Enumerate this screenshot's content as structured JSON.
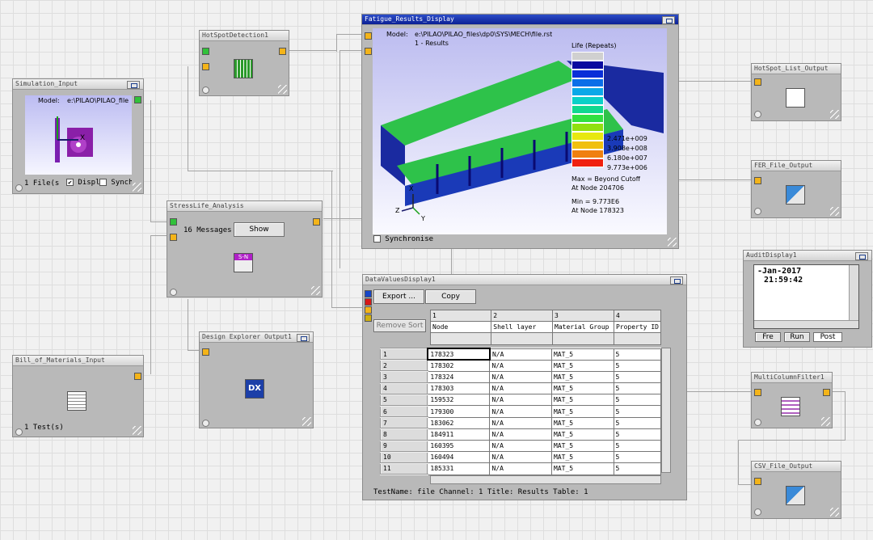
{
  "nodes": {
    "hotspot": {
      "title": "HotSpotDetection1"
    },
    "sim": {
      "title": "Simulation_Input",
      "model": "Model:",
      "path": "e:\\PILAO\\PILAO_file",
      "files": "1 File(s",
      "disp": "Displ",
      "sync": "Synch"
    },
    "fatigue": {
      "title": "Fatigue_Results_Display",
      "model": "Model:",
      "path": "e:\\PILAO\\PILAO_files\\dp0\\SYS\\MECH\\file.rst",
      "results": "1 - Results",
      "legend_title": "Life (Repeats)",
      "legend_values": [
        "2.471e+009",
        "3.908e+008",
        "6.180e+007",
        "9.773e+006"
      ],
      "max": "Max = Beyond Cutoff",
      "max_node": "At Node 204706",
      "min": "Min = 9.773E6",
      "min_node": "At Node 178323",
      "synchronise": "Synchronise"
    },
    "hotspot_out": {
      "title": "HotSpot_List_Output"
    },
    "fer_out": {
      "title": "FER_File_Output"
    },
    "stress": {
      "title": "StressLife_Analysis",
      "messages": "16 Messages",
      "show": "Show",
      "icon_text": "S-N"
    },
    "bom": {
      "title": "Bill_of_Materials_Input",
      "tests": "1 Test(s)"
    },
    "design": {
      "title": "Design Explorer Output1",
      "icon_text": "DX"
    },
    "audit": {
      "title": "AuditDisplay1",
      "lines": [
        "-Jan-2017",
        "21:59:42"
      ],
      "tabs": [
        "Fre",
        "Run",
        "Post"
      ]
    },
    "data": {
      "title": "DataValuesDisplay1",
      "export": "Export ...",
      "copy": "Copy",
      "remove_sort": "Remove Sort",
      "col_numbers": [
        "1",
        "2",
        "3",
        "4"
      ],
      "col_headers": [
        "Node",
        "Shell layer",
        "Material Group",
        "Property ID"
      ],
      "row_numbers": [
        "1",
        "2",
        "3",
        "4",
        "5",
        "6",
        "7",
        "8",
        "9",
        "10",
        "11"
      ],
      "rows": [
        [
          "178323",
          "N/A",
          "MAT_5",
          "5"
        ],
        [
          "178302",
          "N/A",
          "MAT_5",
          "5"
        ],
        [
          "178324",
          "N/A",
          "MAT_5",
          "5"
        ],
        [
          "178303",
          "N/A",
          "MAT_5",
          "5"
        ],
        [
          "159532",
          "N/A",
          "MAT_5",
          "5"
        ],
        [
          "179300",
          "N/A",
          "MAT_5",
          "5"
        ],
        [
          "183062",
          "N/A",
          "MAT_5",
          "5"
        ],
        [
          "184911",
          "N/A",
          "MAT_5",
          "5"
        ],
        [
          "160395",
          "N/A",
          "MAT_5",
          "5"
        ],
        [
          "160494",
          "N/A",
          "MAT_5",
          "5"
        ],
        [
          "185331",
          "N/A",
          "MAT_5",
          "5"
        ]
      ],
      "status": "TestName: file  Channel: 1  Title: Results  Table: 1"
    },
    "multi": {
      "title": "MultiColumnFilter1"
    },
    "csv": {
      "title": "CSV_File_Output"
    }
  },
  "legend_colors": [
    "#d0d0d0",
    "#0a0aa0",
    "#0a2fd8",
    "#0a6ee8",
    "#0aa8e8",
    "#0ad0c8",
    "#10d890",
    "#30e040",
    "#90e010",
    "#e8e810",
    "#f0c010",
    "#f08010",
    "#f02010"
  ]
}
